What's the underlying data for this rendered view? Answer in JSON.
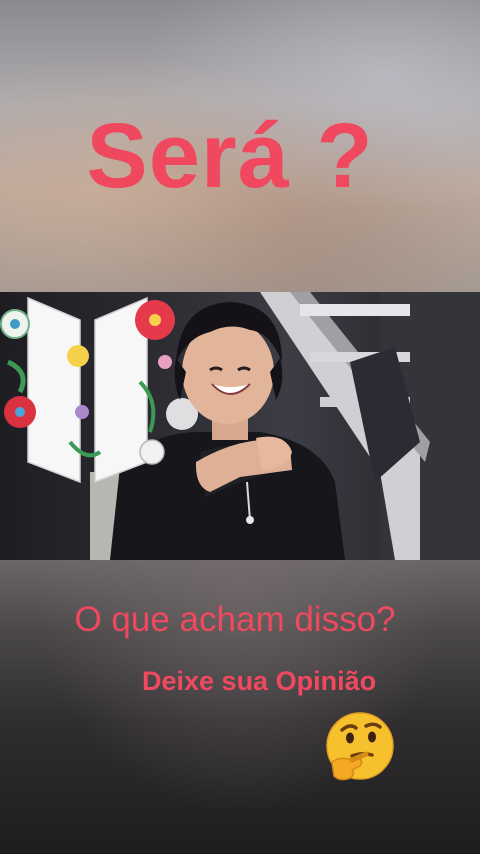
{
  "headline": "Será ?",
  "caption": {
    "main": "O que acham disso?",
    "sub": "Deixe sua Opinião"
  },
  "icons": {
    "logo": "bts-logo-icon",
    "emoji": "thinking-face-emoji"
  },
  "colors": {
    "text_accent": "#f0485e",
    "emoji_yellow": "#f7c12e"
  }
}
